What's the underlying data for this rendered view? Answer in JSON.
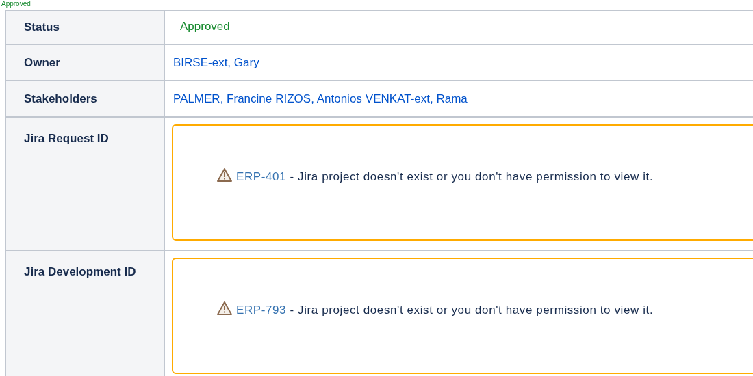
{
  "top_text": "Approved",
  "rows": [
    {
      "label": "Status",
      "kind": "status",
      "value": "Approved"
    },
    {
      "label": "Owner",
      "kind": "people",
      "people": [
        "BIRSE-ext, Gary"
      ]
    },
    {
      "label": "Stakeholders",
      "kind": "people",
      "people": [
        "PALMER, Francine",
        "RIZOS, Antonios",
        "VENKAT-ext, Rama"
      ]
    },
    {
      "label": "Jira Request ID",
      "kind": "jira",
      "issue": "ERP-401",
      "message": "- Jira project doesn't exist or you don't have permission to view it."
    },
    {
      "label": "Jira Development ID",
      "kind": "jira",
      "issue": "ERP-793",
      "message": "- Jira project doesn't exist or you don't have permission to view it."
    }
  ]
}
